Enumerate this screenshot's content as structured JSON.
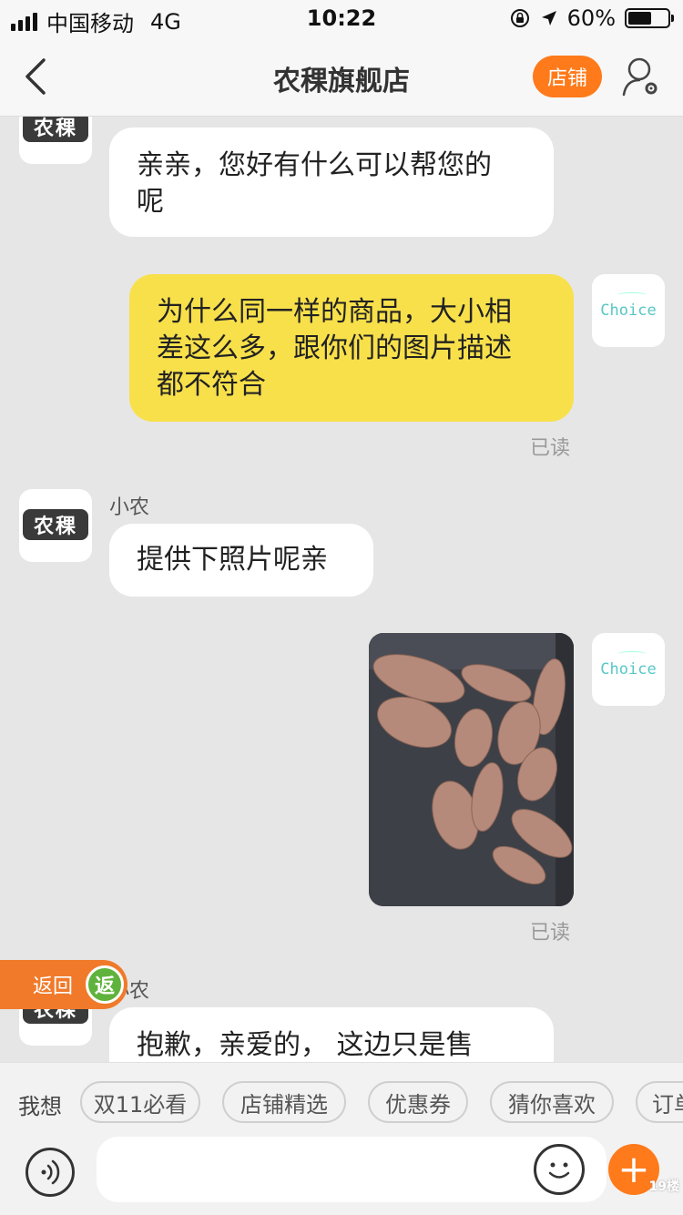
{
  "status_bar": {
    "carrier": "中国移动",
    "network": "4G",
    "time": "10:22",
    "battery": "60%",
    "battery_level": 0.6
  },
  "nav": {
    "title": "农稞旗舰店",
    "shop_button": "店铺"
  },
  "shop_logo_text": "农稞",
  "user_avatar_text": "Choice",
  "messages": [
    {
      "from": "shop",
      "text_lines": [
        "亲亲，您好有什么可以帮您的",
        "呢"
      ]
    },
    {
      "from": "user",
      "text_lines": [
        "为什么同一样的商品，大小相",
        "差这么多，跟你们的图片描述",
        "都不符合"
      ],
      "status": "已读"
    },
    {
      "from": "shop",
      "sender": "小农",
      "text": "提供下照片呢亲"
    },
    {
      "from": "user",
      "type": "image",
      "status": "已读"
    },
    {
      "from": "shop",
      "sender": "小农",
      "text": "抱歉，亲爱的， 这边只是售"
    }
  ],
  "float_back": {
    "label": "返回",
    "icon_text": "返"
  },
  "quick_bar": {
    "label": "我想",
    "chips": [
      "双11必看",
      "店铺精选",
      "优惠券",
      "猜你喜欢",
      "订单"
    ]
  },
  "input_bar": {
    "placeholder": "",
    "plus": "+"
  },
  "watermark": "19楼"
}
